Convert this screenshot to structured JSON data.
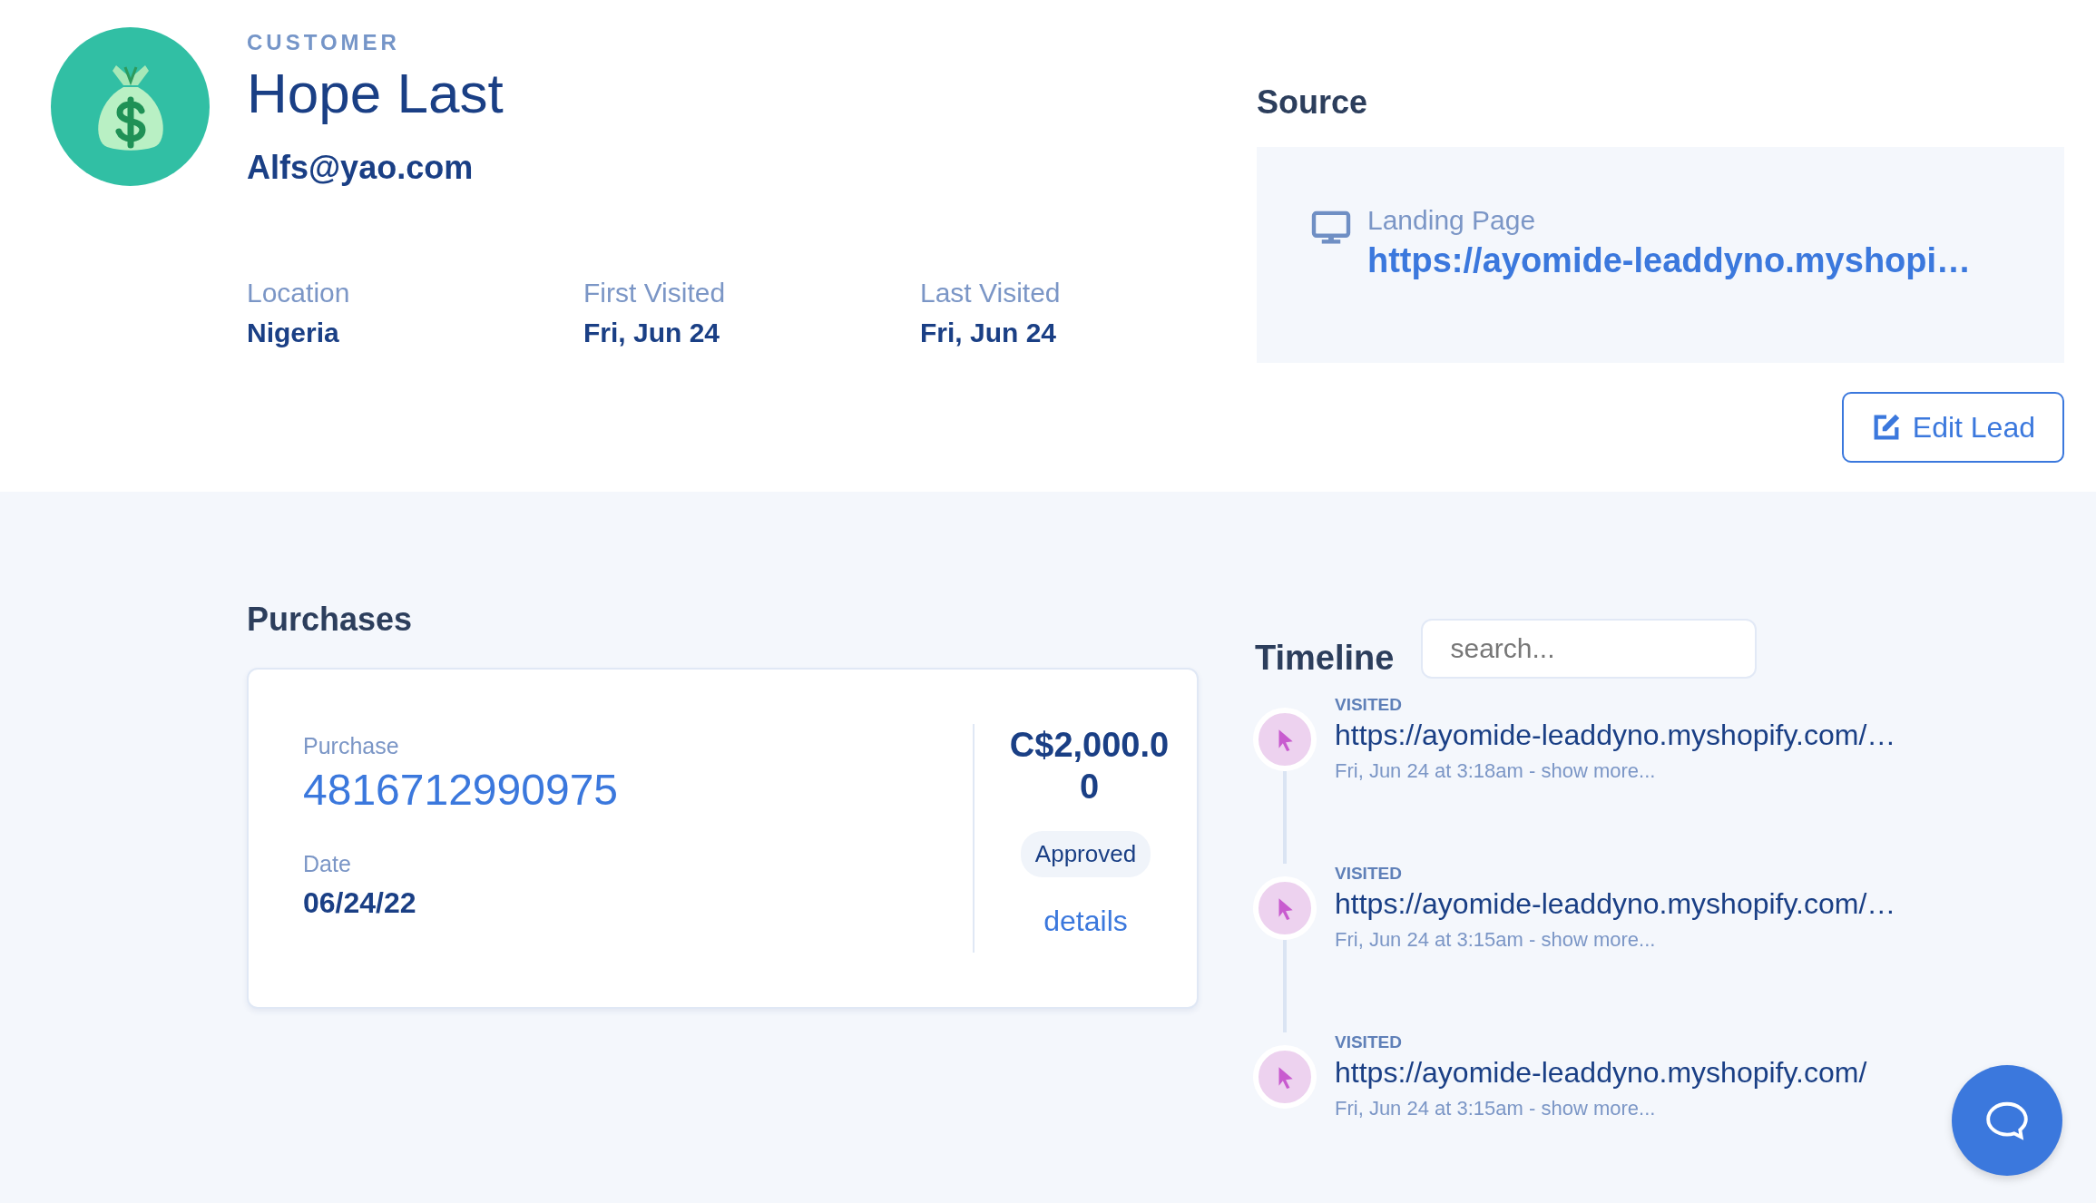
{
  "customer": {
    "eyebrow": "CUSTOMER",
    "name": "Hope Last",
    "email": "Alfs@yao.com",
    "facts": [
      {
        "label": "Location",
        "value": "Nigeria"
      },
      {
        "label": "First Visited",
        "value": "Fri, Jun 24"
      },
      {
        "label": "Last Visited",
        "value": "Fri, Jun 24"
      }
    ]
  },
  "source": {
    "title": "Source",
    "label": "Landing Page",
    "url": "https://ayomide-leaddyno.myshopi…"
  },
  "edit_button": "Edit Lead",
  "purchases": {
    "title": "Purchases",
    "items": [
      {
        "label": "Purchase",
        "number": "4816712990975",
        "date_label": "Date",
        "date": "06/24/22",
        "amount": "C$2,000.00",
        "status": "Approved",
        "link": "details"
      }
    ]
  },
  "timeline": {
    "title": "Timeline",
    "search": {
      "placeholder": "search..."
    },
    "events": [
      {
        "kind": "visit",
        "type": "VISITED",
        "url": "https://ayomide-leaddyno.myshopify.com/…",
        "time": "Fri, Jun 24 at 3:18am - ",
        "more": "show more..."
      },
      {
        "kind": "visit",
        "type": "VISITED",
        "url": "https://ayomide-leaddyno.myshopify.com/…",
        "time": "Fri, Jun 24 at 3:15am - ",
        "more": "show more..."
      },
      {
        "kind": "visit",
        "type": "VISITED",
        "url": "https://ayomide-leaddyno.myshopify.com/",
        "time": "Fri, Jun 24 at 3:15am - ",
        "more": "show more..."
      }
    ]
  }
}
